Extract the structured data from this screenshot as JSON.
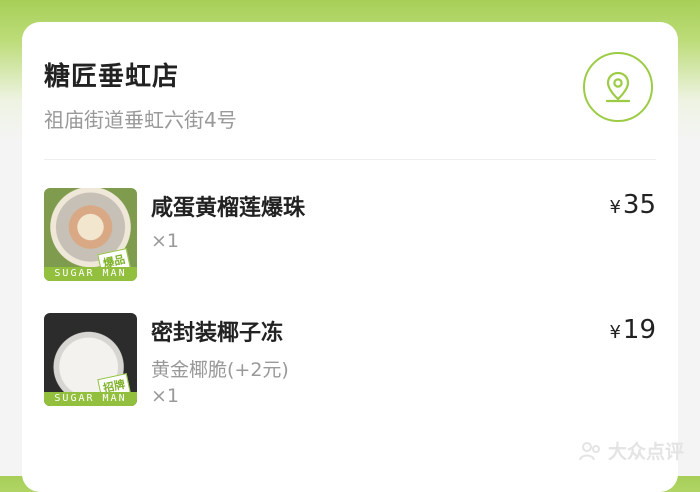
{
  "store": {
    "name": "糖匠垂虹店",
    "address": "祖庙街道垂虹六街4号"
  },
  "items": [
    {
      "name": "咸蛋黄榴莲爆珠",
      "spec": "",
      "qty": "×1",
      "currency": "¥",
      "price": "35",
      "thumb_band": "SUGAR MAN",
      "thumb_tag": "爆品"
    },
    {
      "name": "密封装椰子冻",
      "spec": "黄金椰脆(+2元)",
      "qty": "×1",
      "currency": "¥",
      "price": "19",
      "thumb_band": "SUGAR MAN",
      "thumb_tag": "招牌"
    }
  ],
  "watermark": "大众点评",
  "colors": {
    "accent": "#9ccc45",
    "header_gradient": "#a7cf58"
  },
  "icons": {
    "location": "location-pin-icon",
    "watermark_logo": "dianping-logo-icon"
  }
}
